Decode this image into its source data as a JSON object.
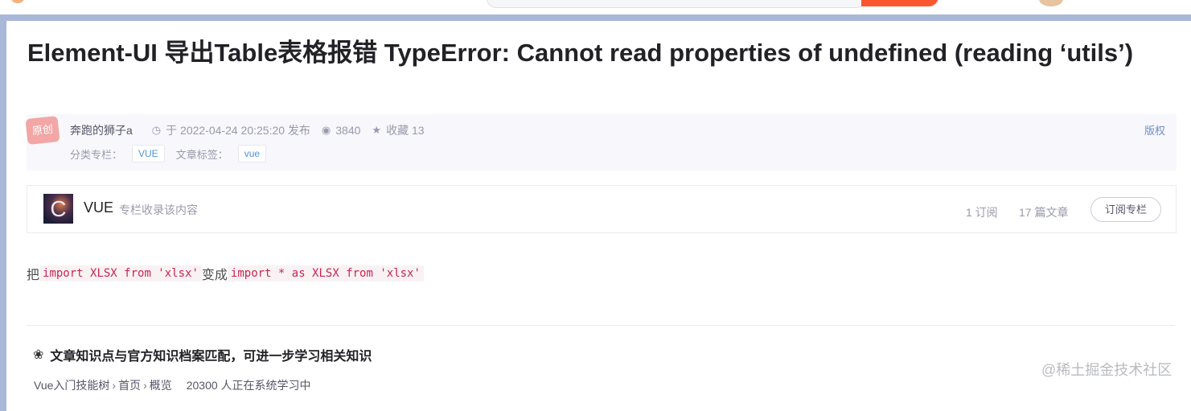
{
  "article": {
    "title": "Element-UI 导出Table表格报错 TypeError: Cannot read properties of undefined (reading ‘utils’)",
    "badge": "原创",
    "author": "奔跑的狮子a",
    "time": "于 2022-04-24 20:25:20 发布",
    "views": "3840",
    "favorites": "收藏 13",
    "copyright": "版权",
    "category_label": "分类专栏：",
    "category_tag": "VUE",
    "tags_label": "文章标签：",
    "tag": "vue"
  },
  "column": {
    "avatar_letter": "C",
    "name": "VUE",
    "description": "专栏收录该内容",
    "subscribers": "1 订阅",
    "articles": "17 篇文章",
    "subscribe_button": "订阅专栏"
  },
  "content": {
    "prefix": "把",
    "code1": "import XLSX from 'xlsx'",
    "middle": "变成",
    "code2": "import * as XLSX from 'xlsx'"
  },
  "knowledge": {
    "title": "文章知识点与官方知识档案匹配，可进一步学习相关知识",
    "path": [
      "Vue入门技能树",
      "首页",
      "概览"
    ],
    "learners": "20300 人正在系统学习中"
  },
  "watermark": "@稀土掘金技术社区"
}
